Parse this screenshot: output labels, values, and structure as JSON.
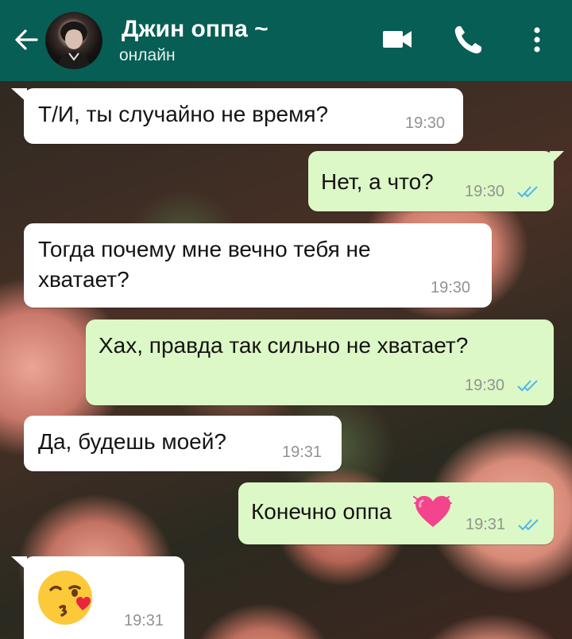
{
  "header": {
    "contact_name": "Джин оппа ~",
    "status": "онлайн",
    "icons": {
      "back": "arrow-left-icon",
      "video": "video-call-icon",
      "call": "phone-icon",
      "menu": "more-vertical-icon"
    }
  },
  "colors": {
    "header_bg": "#075e54",
    "incoming_bubble": "#ffffff",
    "outgoing_bubble": "#dcf8c6",
    "read_ticks": "#4fb6ec",
    "time_text": "#8f948f"
  },
  "messages": [
    {
      "direction": "in",
      "text": "Т/И, ты случайно не время?",
      "time": "19:30"
    },
    {
      "direction": "out",
      "text": "Нет, а что?",
      "time": "19:30",
      "read": true
    },
    {
      "direction": "in",
      "text_lines": [
        "Тогда почему мне вечно тебя не",
        "хватает?"
      ],
      "time": "19:30"
    },
    {
      "direction": "out",
      "text": "Хах, правда так сильно не хватает?",
      "time": "19:30",
      "read": true
    },
    {
      "direction": "in",
      "text": "Да, будешь моей?",
      "time": "19:31"
    },
    {
      "direction": "out",
      "text": "Конечно оппа",
      "emoji": "growing-heart-emoji",
      "time": "19:31",
      "read": true
    },
    {
      "direction": "in",
      "emoji": "face-blowing-kiss-emoji",
      "time": "19:31"
    }
  ]
}
